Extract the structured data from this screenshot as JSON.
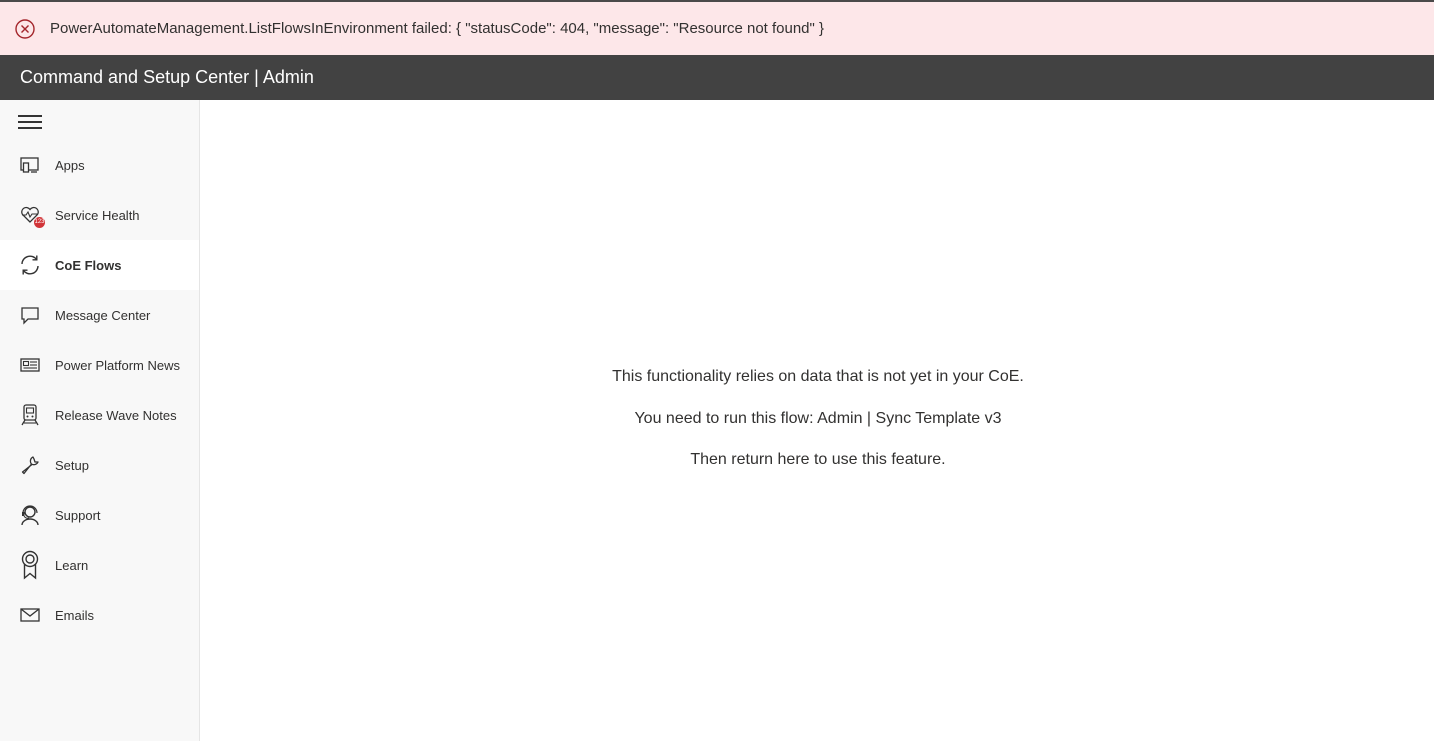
{
  "error_banner": {
    "icon": "error-circle-icon",
    "message": "PowerAutomateManagement.ListFlowsInEnvironment failed: { \"statusCode\": 404, \"message\": \"Resource not found\" }",
    "background": "#fde7e9",
    "icon_color": "#a4262c"
  },
  "header": {
    "title": "Command and Setup Center | Admin",
    "background": "#424242"
  },
  "sidebar": {
    "menu_icon": "hamburger-icon",
    "items": [
      {
        "label": "Apps",
        "icon": "apps-icon"
      },
      {
        "label": "Service Health",
        "icon": "heart-pulse-icon",
        "badge": "123"
      },
      {
        "label": "CoE Flows",
        "icon": "sync-icon",
        "selected": true
      },
      {
        "label": "Message Center",
        "icon": "chat-bubble-icon"
      },
      {
        "label": "Power Platform News",
        "icon": "news-icon"
      },
      {
        "label": "Release Wave Notes",
        "icon": "train-icon"
      },
      {
        "label": "Setup",
        "icon": "wrench-icon"
      },
      {
        "label": "Support",
        "icon": "headset-icon"
      },
      {
        "label": "Learn",
        "icon": "ribbon-icon"
      },
      {
        "label": "Emails",
        "icon": "mail-icon"
      }
    ]
  },
  "main": {
    "notice_lines": [
      "This functionality relies on data that is not yet in your CoE.",
      "You need to run this flow: Admin | Sync Template v3",
      "Then return here to use this feature."
    ]
  }
}
